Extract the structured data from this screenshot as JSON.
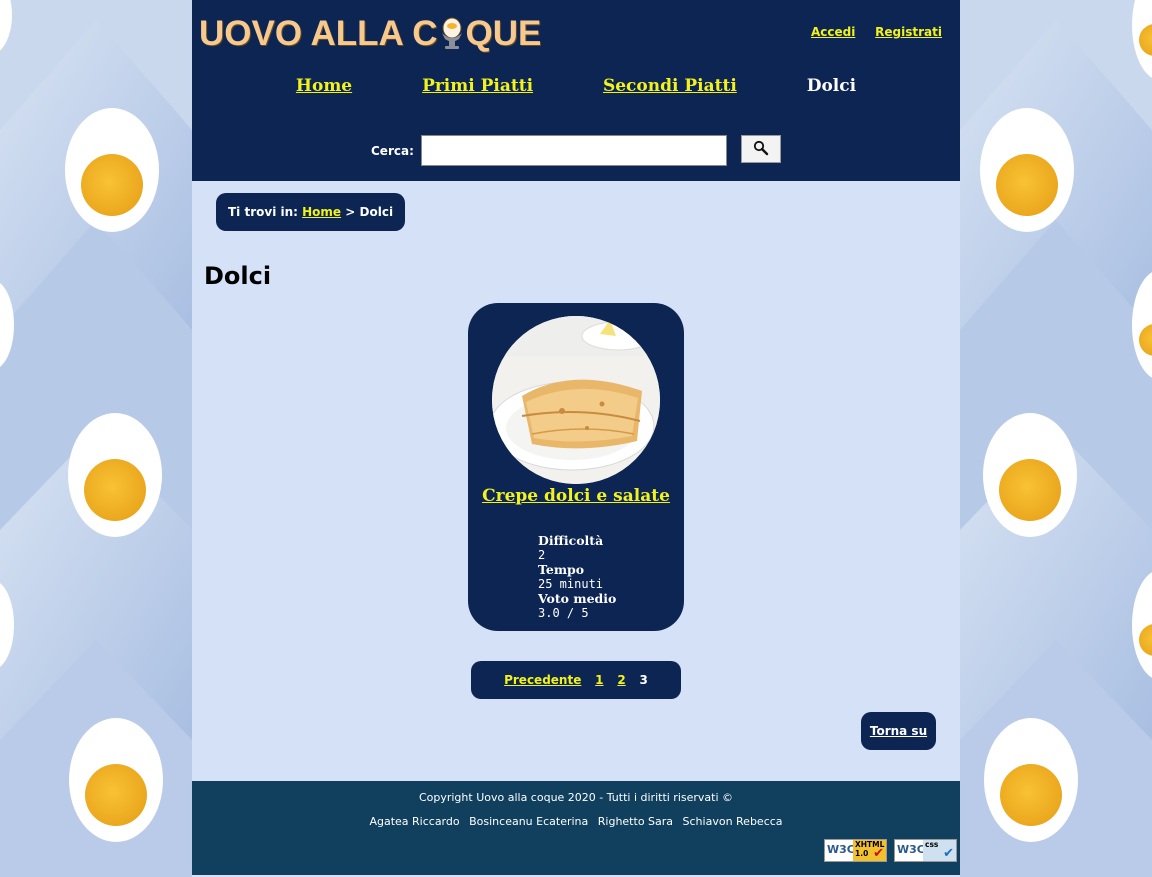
{
  "header": {
    "logo_text_before": "UOVO ALLA C",
    "logo_text_after": "QUE",
    "auth": {
      "login": "Accedi",
      "register": "Registrati"
    },
    "nav": [
      {
        "label": "Home",
        "current": false
      },
      {
        "label": "Primi Piatti",
        "current": false
      },
      {
        "label": "Secondi Piatti",
        "current": false
      },
      {
        "label": "Dolci",
        "current": true
      }
    ],
    "search": {
      "label": "Cerca:",
      "value": "",
      "button_icon": "search-icon"
    }
  },
  "breadcrumb": {
    "prefix": "Ti trovi in:",
    "home": "Home",
    "separator": ">",
    "current": "Dolci"
  },
  "page_title": "Dolci",
  "recipes": [
    {
      "title": "Crepe dolci e salate",
      "difficulty_label": "Difficoltà",
      "difficulty_value": "2",
      "time_label": "Tempo",
      "time_value": "25 minuti",
      "rating_label": "Voto medio",
      "rating_value": "3.0 / 5"
    }
  ],
  "pagination": {
    "previous": "Precedente",
    "pages": [
      "1",
      "2"
    ],
    "current": "3"
  },
  "back_to_top": "Torna su",
  "footer": {
    "copyright": "Copyright Uovo alla coque 2020 - Tutti i diritti riservati ©",
    "authors": [
      "Agatea Riccardo",
      "Bosinceanu Ecaterina",
      "Righetto Sara",
      "Schiavon Rebecca"
    ],
    "badges": [
      {
        "w3c": "W3C",
        "tag_line1": "XHTML",
        "tag_line2": "1.0",
        "check": "✔"
      },
      {
        "w3c": "W3C",
        "tag_line1": "css",
        "tag_line2": "",
        "check": "✔"
      }
    ]
  },
  "colors": {
    "header_bg": "#0c2553",
    "content_bg": "#d4e1f6",
    "footer_bg": "#10405e",
    "link": "#f3f21a",
    "logo": "#f6c98e"
  }
}
